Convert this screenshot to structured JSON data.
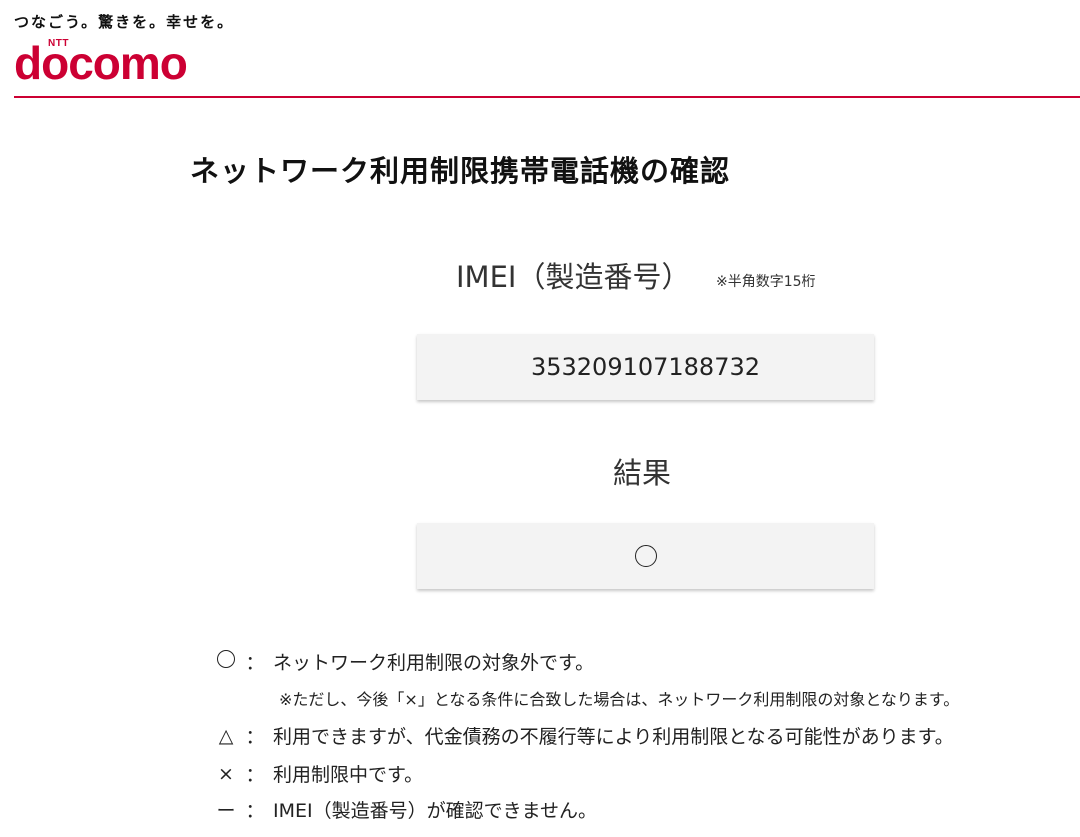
{
  "header": {
    "tagline": "つなごう。驚きを。幸せを。",
    "logo_small": "NTT",
    "logo_word": "docomo",
    "brand_color": "#cc0033"
  },
  "main": {
    "title": "ネットワーク利用制限携帯電話機の確認",
    "imei_label": "IMEI（製造番号）",
    "imei_note": "※半角数字15桁",
    "imei_value": "353209107188732",
    "result_label": "結果",
    "result_icon": "circle-icon"
  },
  "legend": {
    "colon": "：",
    "items": [
      {
        "symbol": "circle-icon",
        "text": "ネットワーク利用制限の対象外です。"
      },
      {
        "symbol": "△",
        "text": "利用できますが、代金債務の不履行等により利用制限となる可能性があります。"
      },
      {
        "symbol": "×",
        "text": "利用制限中です。"
      },
      {
        "symbol": "ー",
        "text": "IMEI（製造番号）が確認できません。"
      }
    ],
    "note": "※ただし、今後「×」となる条件に合致した場合は、ネットワーク利用制限の対象となります。"
  }
}
